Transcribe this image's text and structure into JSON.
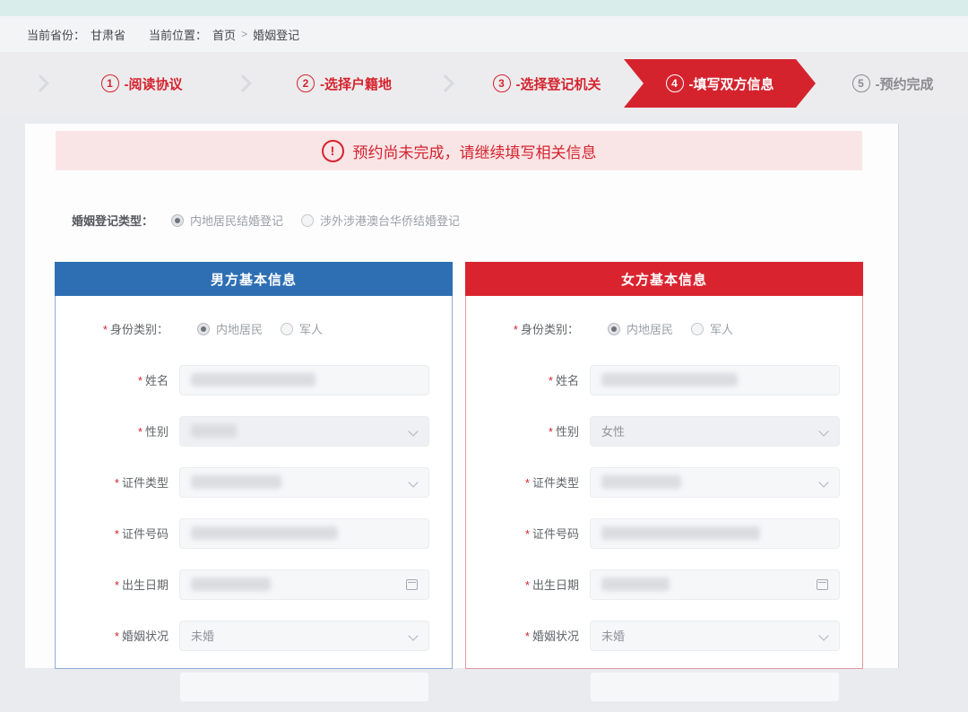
{
  "ui": {
    "required_mark": "*",
    "steps_separator": "-"
  },
  "colors": {
    "accent_red": "#d5232e",
    "groom_blue": "#2e6fb4",
    "bride_red": "#d9242f",
    "notice_bg": "#f9e5e6",
    "top_strip": "#d9eeea"
  },
  "breadcrumb": {
    "province_label": "当前省份：",
    "province": "甘肃省",
    "location_label": "当前位置：",
    "home": "首页",
    "separator": ">",
    "current": "婚姻登记"
  },
  "steps": [
    {
      "num": "1",
      "label": "阅读协议",
      "state": "done"
    },
    {
      "num": "2",
      "label": "选择户籍地",
      "state": "done"
    },
    {
      "num": "3",
      "label": "选择登记机关",
      "state": "done"
    },
    {
      "num": "4",
      "label": "填写双方信息",
      "state": "active"
    },
    {
      "num": "5",
      "label": "预约完成",
      "state": "todo"
    }
  ],
  "notice": {
    "icon": "!",
    "text": "预约尚未完成，请继续填写相关信息"
  },
  "registration_type": {
    "label": "婚姻登记类型：",
    "options": [
      {
        "label": "内地居民结婚登记",
        "selected": true
      },
      {
        "label": "涉外涉港澳台华侨结婚登记",
        "selected": false
      }
    ]
  },
  "panels": [
    {
      "key": "groom",
      "title": "男方基本信息",
      "theme": "blue",
      "fields": [
        {
          "key": "identity-type",
          "kind": "radio-group",
          "label": "身份类别：",
          "required": true,
          "options": [
            {
              "label": "内地居民",
              "selected": true
            },
            {
              "label": "军人",
              "selected": false
            }
          ]
        },
        {
          "key": "name",
          "kind": "input",
          "label": "姓名",
          "required": true,
          "value": "",
          "redacted": true,
          "blob_pct": 55
        },
        {
          "key": "gender",
          "kind": "select",
          "label": "性别",
          "required": true,
          "value": "",
          "redacted": true,
          "blob_pct": 20,
          "disabled": true
        },
        {
          "key": "id-type",
          "kind": "select",
          "label": "证件类型",
          "required": true,
          "value": "",
          "redacted": true,
          "blob_pct": 40
        },
        {
          "key": "id-number",
          "kind": "input",
          "label": "证件号码",
          "required": true,
          "value": "",
          "redacted": true,
          "blob_pct": 65
        },
        {
          "key": "birth-date",
          "kind": "date",
          "label": "出生日期",
          "required": true,
          "value": "",
          "redacted": true,
          "blob_pct": 35
        },
        {
          "key": "marital-status",
          "kind": "select",
          "label": "婚姻状况",
          "required": true,
          "value": "未婚"
        },
        {
          "key": "extra",
          "kind": "input",
          "label": "",
          "required": false,
          "value": "",
          "partial": true
        }
      ]
    },
    {
      "key": "bride",
      "title": "女方基本信息",
      "theme": "red",
      "fields": [
        {
          "key": "identity-type",
          "kind": "radio-group",
          "label": "身份类别：",
          "required": true,
          "options": [
            {
              "label": "内地居民",
              "selected": true
            },
            {
              "label": "军人",
              "selected": false
            }
          ]
        },
        {
          "key": "name",
          "kind": "input",
          "label": "姓名",
          "required": true,
          "value": "",
          "redacted": true,
          "blob_pct": 60
        },
        {
          "key": "gender",
          "kind": "select",
          "label": "性别",
          "required": true,
          "value": "女性",
          "disabled": true
        },
        {
          "key": "id-type",
          "kind": "select",
          "label": "证件类型",
          "required": true,
          "value": "",
          "redacted": true,
          "blob_pct": 35
        },
        {
          "key": "id-number",
          "kind": "input",
          "label": "证件号码",
          "required": true,
          "value": "",
          "redacted": true,
          "blob_pct": 70
        },
        {
          "key": "birth-date",
          "kind": "date",
          "label": "出生日期",
          "required": true,
          "value": "",
          "redacted": true,
          "blob_pct": 30
        },
        {
          "key": "marital-status",
          "kind": "select",
          "label": "婚姻状况",
          "required": true,
          "value": "未婚"
        },
        {
          "key": "extra",
          "kind": "input",
          "label": "",
          "required": false,
          "value": "",
          "partial": true
        }
      ]
    }
  ]
}
